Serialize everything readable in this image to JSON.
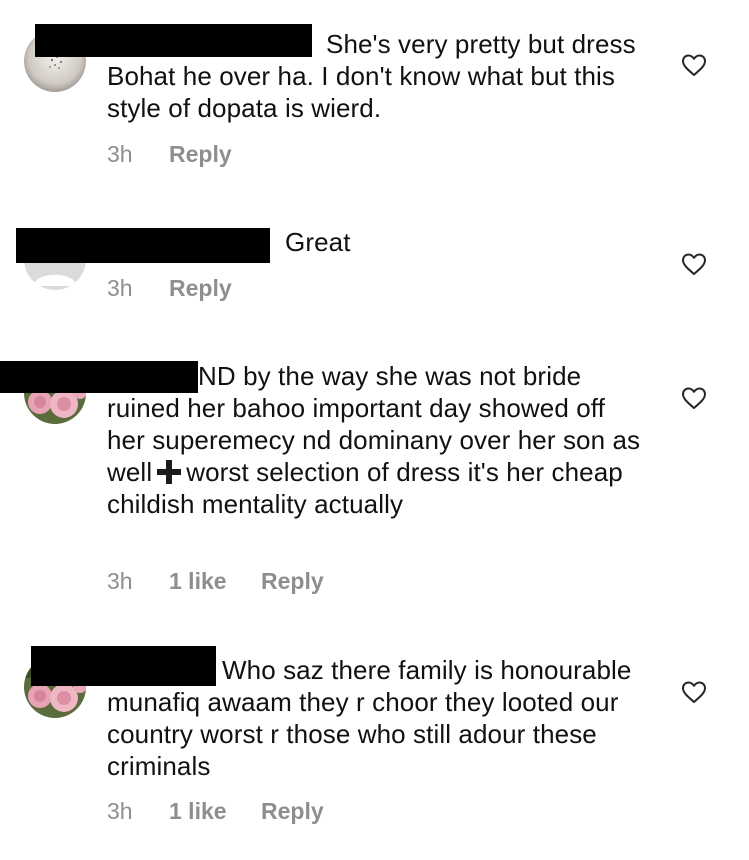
{
  "comments": [
    {
      "text_first": "She's very pretty but",
      "text_rest": "dress Bohat he over ha. I don't know what but this style of dopata is wierd.",
      "time": "3h",
      "likes": "",
      "reply_label": "Reply",
      "avatar": "starry-sky-avatar",
      "like_icon": "heart-outline-icon"
    },
    {
      "text_first": "Great",
      "text_rest": "",
      "time": "3h",
      "likes": "",
      "reply_label": "Reply",
      "avatar": "default-user-avatar",
      "like_icon": "heart-outline-icon"
    },
    {
      "text_first": "ND by the way she was not",
      "text_rest_a": "bride ruined her bahoo important day showed off her superemecy nd dominany over her son as well",
      "emoji": "heavy-plus-sign",
      "text_rest_b": "worst selection of dress it's her cheap childish mentality actually",
      "time": "3h",
      "likes": "1 like",
      "reply_label": "Reply",
      "avatar": "pink-roses-avatar",
      "like_icon": "heart-outline-icon"
    },
    {
      "text_first": "Who saz there family is",
      "text_rest": "honourable munafiq awaam they r choor they looted our country worst r those who still adour these criminals",
      "time": "3h",
      "likes": "1 like",
      "reply_label": "Reply",
      "avatar": "pink-roses-avatar",
      "like_icon": "heart-outline-icon"
    }
  ],
  "colors": {
    "meta_gray": "#8e8e8e",
    "text": "#111111",
    "redaction": "#000000"
  }
}
